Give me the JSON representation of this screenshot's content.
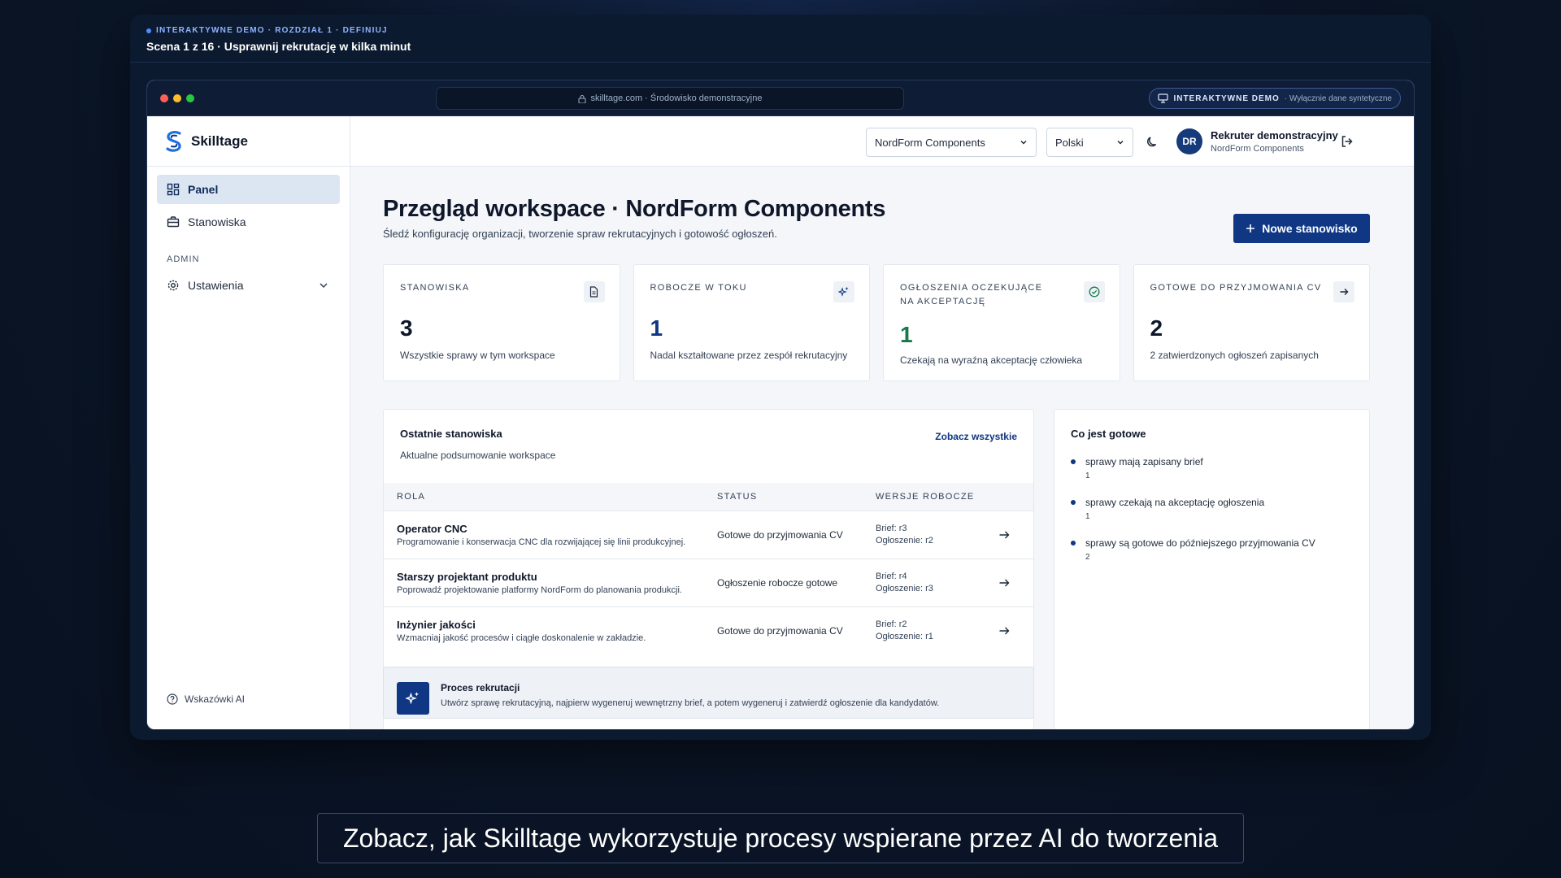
{
  "stage": {
    "eyebrow": "INTERAKTYWNE DEMO · ROZDZIAŁ 1 · DEFINIUJ",
    "scene_title": "Scena 1 z 16 · Usprawnij rekrutację w kilka minut"
  },
  "browser": {
    "url": "skilltage.com · Środowisko demonstracyjne",
    "demo_badge": "INTERAKTYWNE DEMO",
    "demo_note": "· Wyłącznie dane syntetyczne"
  },
  "sidebar": {
    "logo": "Skilltage",
    "items": [
      {
        "label": "Panel",
        "icon": "dashboard-icon"
      },
      {
        "label": "Stanowiska",
        "icon": "briefcase-icon"
      }
    ],
    "section_admin": "ADMIN",
    "settings_label": "Ustawienia",
    "ai_tips": "Wskazówki AI"
  },
  "topbar": {
    "company_select": "NordForm Components",
    "language_select": "Polski",
    "avatar_initials": "DR",
    "user_name": "Rekruter demonstracyjny",
    "user_org": "NordForm Components"
  },
  "main": {
    "title": "Przegląd workspace · NordForm Components",
    "subtitle": "Śledź konfigurację organizacji, tworzenie spraw rekrutacyjnych i gotowość ogłoszeń.",
    "new_button": "Nowe stanowisko"
  },
  "stats": [
    {
      "label": "STANOWISKA",
      "value": "3",
      "desc": "Wszystkie sprawy w tym workspace"
    },
    {
      "label": "ROBOCZE W TOKU",
      "value": "1",
      "desc": "Nadal kształtowane przez zespół rekrutacyjny"
    },
    {
      "label": "OGŁOSZENIA OCZEKUJĄCE NA AKCEPTACJĘ",
      "value": "1",
      "desc": "Czekają na wyraźną akceptację człowieka"
    },
    {
      "label": "GOTOWE DO PRZYJMOWANIA CV",
      "value": "2",
      "desc": "2 zatwierdzonych ogłoszeń zapisanych"
    }
  ],
  "recent": {
    "title": "Ostatnie stanowiska",
    "subtitle": "Aktualne podsumowanie workspace",
    "see_all": "Zobacz wszystkie",
    "columns": [
      "ROLA",
      "STATUS",
      "WERSJE ROBOCZE"
    ],
    "rows": [
      {
        "role": "Operator CNC",
        "desc": "Programowanie i konserwacja CNC dla rozwijającej się linii produkcyjnej.",
        "status": "Gotowe do przyjmowania CV",
        "brief": "Brief: r3",
        "ad": "Ogłoszenie: r2"
      },
      {
        "role": "Starszy projektant produktu",
        "desc": "Poprowadź projektowanie platformy NordForm do planowania produkcji.",
        "status": "Ogłoszenie robocze gotowe",
        "brief": "Brief: r4",
        "ad": "Ogłoszenie: r3"
      },
      {
        "role": "Inżynier jakości",
        "desc": "Wzmacniaj jakość procesów i ciągłe doskonalenie w zakładzie.",
        "status": "Gotowe do przyjmowania CV",
        "brief": "Brief: r2",
        "ad": "Ogłoszenie: r1"
      }
    ]
  },
  "ready": {
    "title": "Co jest gotowe",
    "items": [
      {
        "text": "sprawy mają zapisany brief",
        "count": "1"
      },
      {
        "text": "sprawy czekają na akceptację ogłoszenia",
        "count": "1"
      },
      {
        "text": "sprawy są gotowe do późniejszego przyjmowania CV",
        "count": "2"
      }
    ]
  },
  "process": {
    "title": "Proces rekrutacji",
    "subtitle": "Utwórz sprawę rekrutacyjną, najpierw wygeneruj wewnętrzny brief, a potem wygeneruj i zatwierdź ogłoszenie dla kandydatów."
  },
  "caption": "Zobacz, jak Skilltage wykorzystuje procesy wspierane przez AI do tworzenia",
  "colors": {
    "accent": "#0f3784",
    "success": "#16794a",
    "bg_dark": "#0b1628"
  }
}
